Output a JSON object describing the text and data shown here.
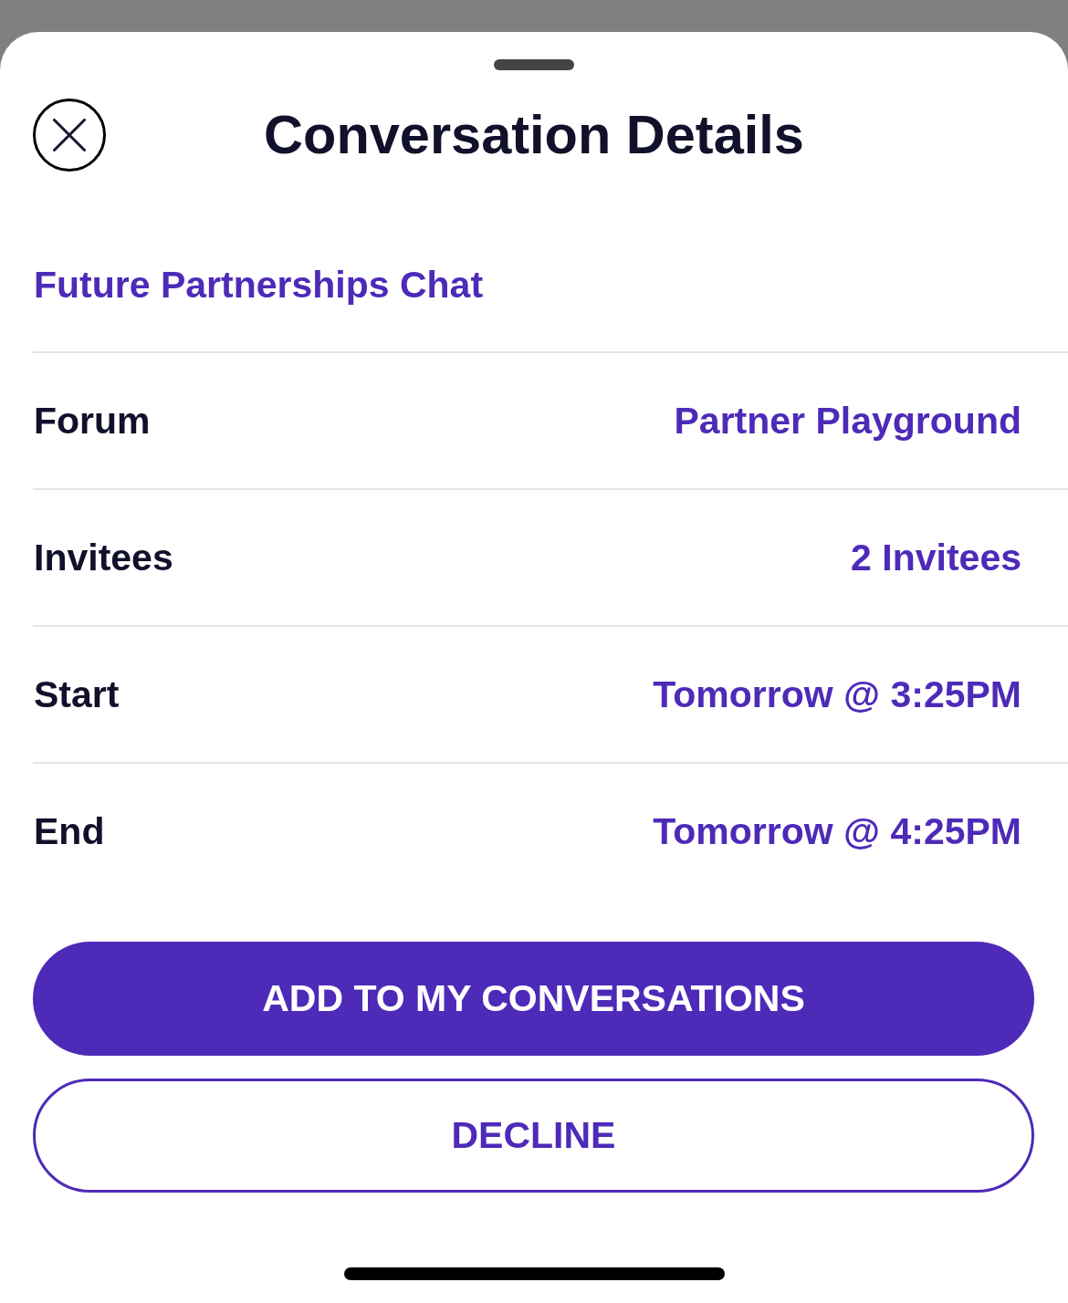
{
  "sheet": {
    "title": "Conversation Details"
  },
  "conversation": {
    "name": "Future Partnerships Chat"
  },
  "details": [
    {
      "label": "Forum",
      "value": "Partner Playground"
    },
    {
      "label": "Invitees",
      "value": "2 Invitees"
    },
    {
      "label": "Start",
      "value": "Tomorrow @ 3:25PM"
    },
    {
      "label": "End",
      "value": "Tomorrow @ 4:25PM"
    }
  ],
  "actions": [
    {
      "label": "ADD TO MY CONVERSATIONS",
      "kind": "primary"
    },
    {
      "label": "DECLINE",
      "kind": "outline"
    }
  ]
}
